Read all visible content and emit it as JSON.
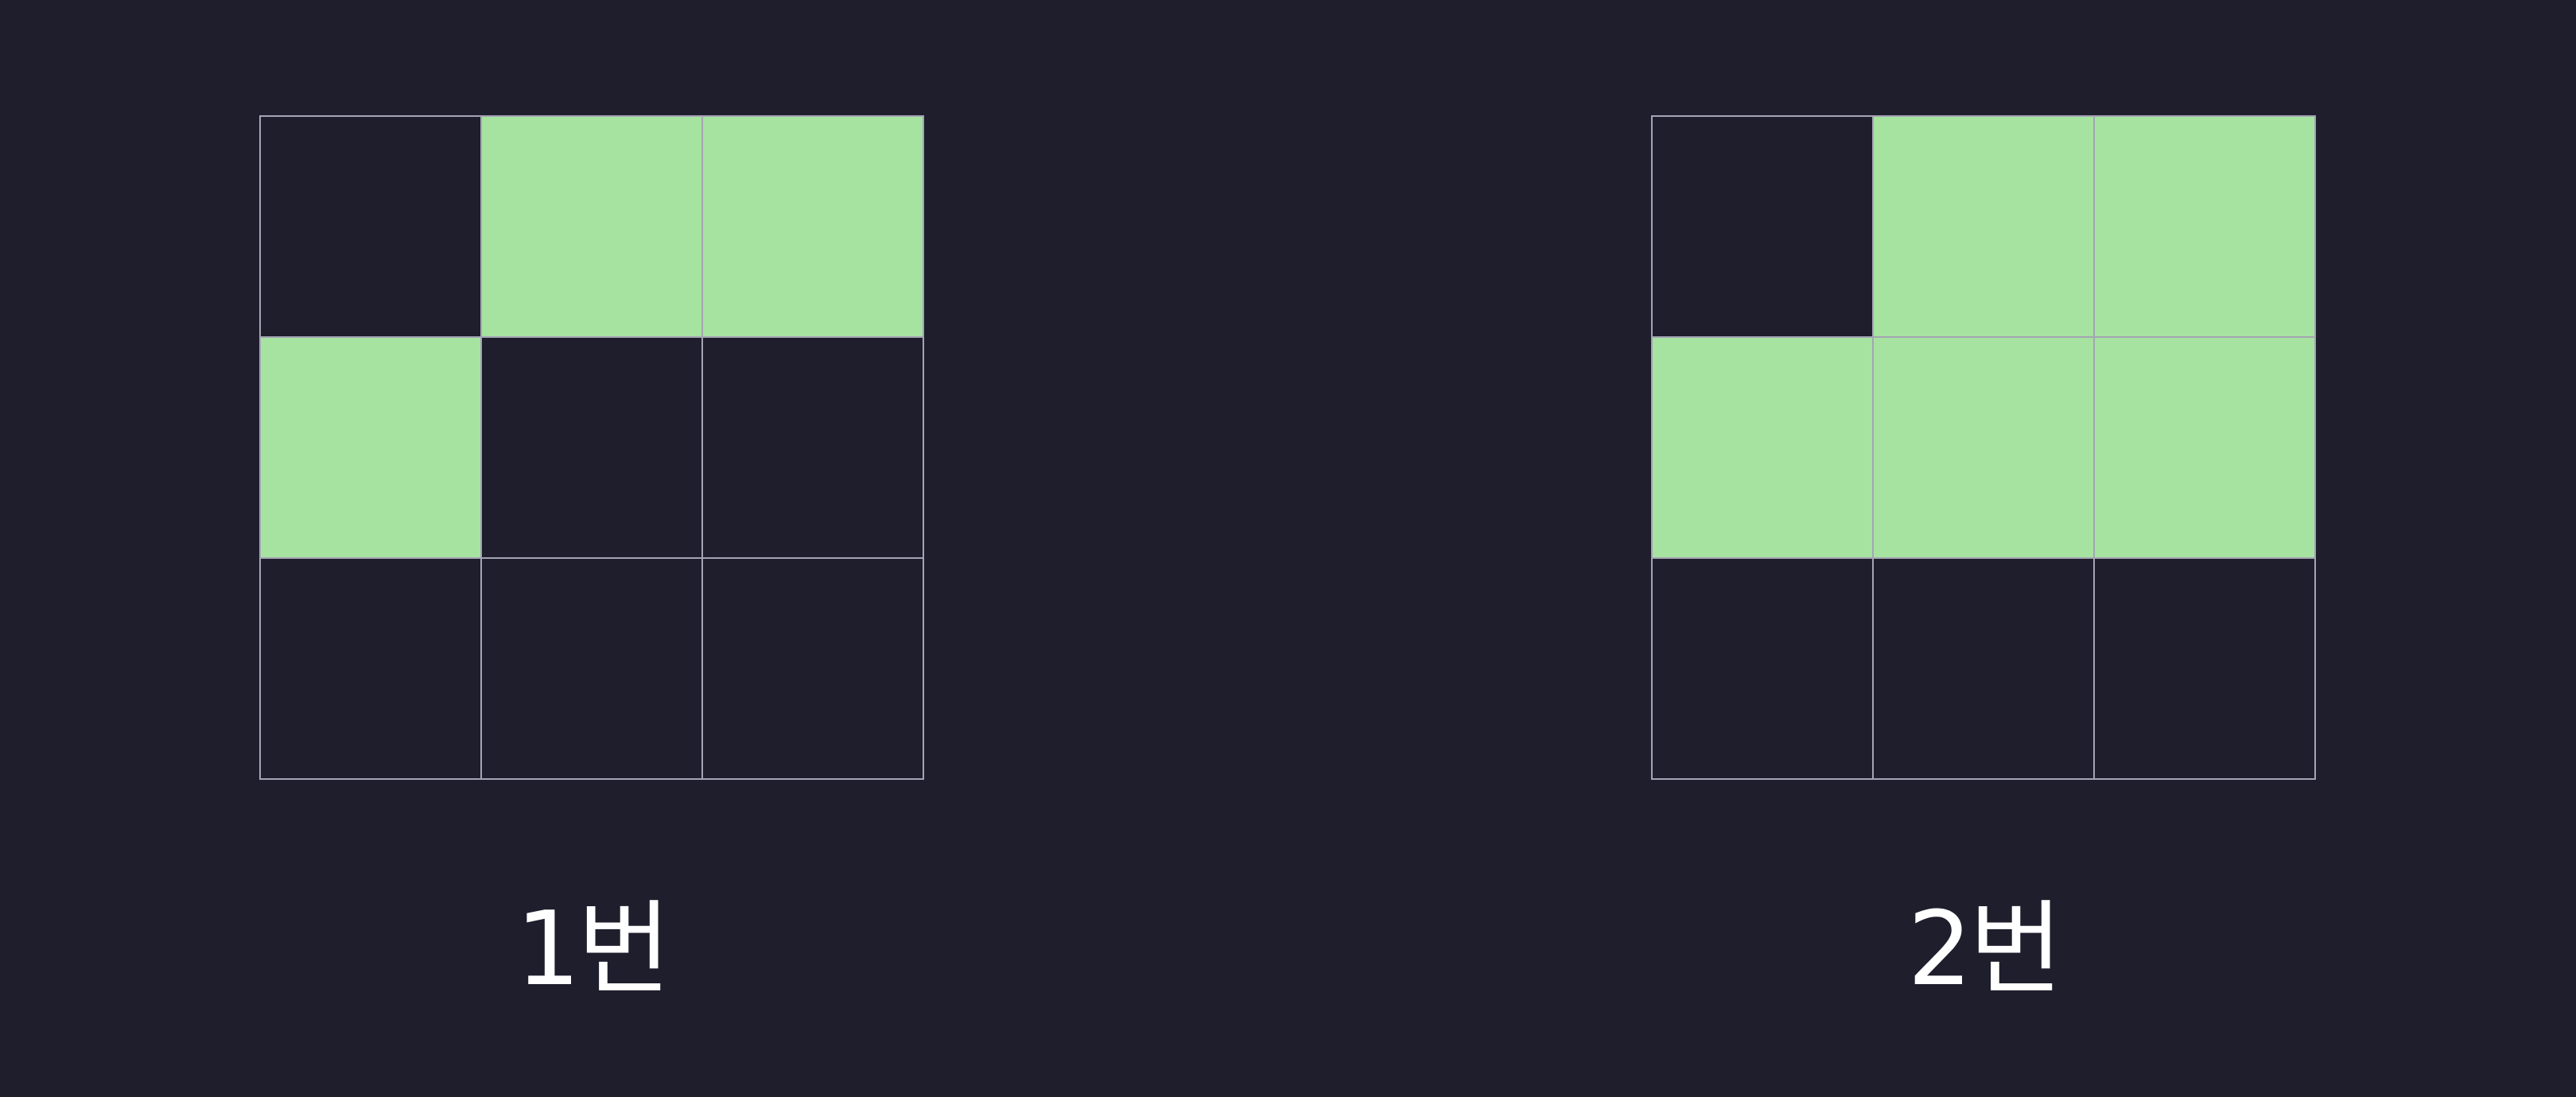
{
  "colors": {
    "background": "#1e1e2d",
    "grid_line": "#a4a4b4",
    "filled_cell": "#a6e3a1",
    "label_text": "#ffffff"
  },
  "panels": [
    {
      "label": "1번",
      "cells": [
        [
          0,
          1,
          1
        ],
        [
          1,
          0,
          0
        ],
        [
          0,
          0,
          0
        ]
      ]
    },
    {
      "label": "2번",
      "cells": [
        [
          0,
          1,
          1
        ],
        [
          1,
          1,
          1
        ],
        [
          0,
          0,
          0
        ]
      ]
    }
  ]
}
